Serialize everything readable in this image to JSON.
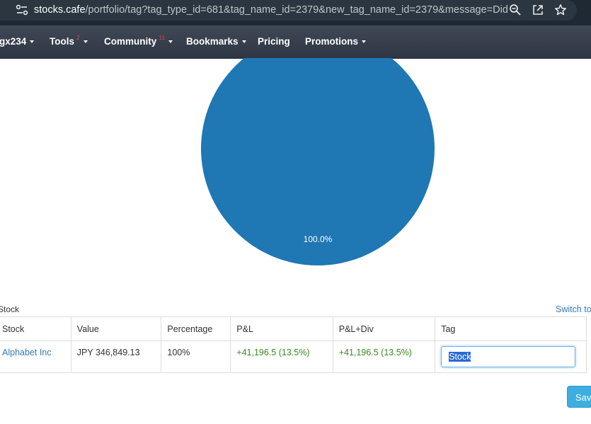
{
  "browser": {
    "url_domain": "stocks.cafe",
    "url_path": "/portfolio/tag?tag_type_id=681&tag_name_id=2379&new_tag_name_id=2379&message=Did+..."
  },
  "navbar": {
    "user_label": "gx234",
    "items": [
      {
        "label": "Tools",
        "badge": "2"
      },
      {
        "label": "Community",
        "badge": "11"
      },
      {
        "label": "Bookmarks",
        "badge": ""
      },
      {
        "label": "Pricing",
        "badge": ""
      },
      {
        "label": "Promotions",
        "badge": ""
      }
    ]
  },
  "chart_data": {
    "type": "pie",
    "slices": [
      {
        "label": "Alphabet Inc",
        "value": 100.0,
        "color": "#1f77b4"
      }
    ],
    "data_labels": [
      "100.0%"
    ]
  },
  "table": {
    "caption": "Stock",
    "switch_label": "Switch to",
    "headers": [
      "Stock",
      "Value",
      "Percentage",
      "P&L",
      "P&L+Div",
      "Tag"
    ],
    "rows": [
      {
        "stock": "Alphabet Inc",
        "value": "JPY 346,849.13",
        "percentage": "100%",
        "pnl": "+41,196.5 (13.5%)",
        "pnl_div": "+41,196.5 (13.5%)",
        "tag": "Stock"
      }
    ]
  },
  "save_label": "Save",
  "colors": {
    "pie": "#1f77b4",
    "link": "#337ab7",
    "positive": "#3a8a1f",
    "save_button": "#3daee0",
    "navbar": "#363d4b"
  }
}
